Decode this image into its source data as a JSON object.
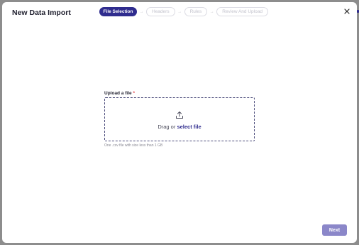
{
  "dialog": {
    "title": "New Data Import",
    "close_icon": "close-icon"
  },
  "stepper": {
    "steps": [
      {
        "label": "File Selection",
        "state": "active"
      },
      {
        "label": "Headers",
        "state": "inactive"
      },
      {
        "label": "Rules",
        "state": "inactive"
      },
      {
        "label": "Review And Upload",
        "state": "inactive"
      }
    ],
    "separator": "→"
  },
  "upload": {
    "label": "Upload a file",
    "required_mark": "*",
    "icon": "upload-icon",
    "drag_text": "Drag or",
    "select_link": "select file",
    "hint": "One .csv file with size less than 1 GB"
  },
  "footer": {
    "next_label": "Next"
  },
  "colors": {
    "accent": "#2f2c8e",
    "next_disabled": "#8b87c9",
    "required": "#e0363c",
    "backdrop": "#8d8d8d"
  }
}
